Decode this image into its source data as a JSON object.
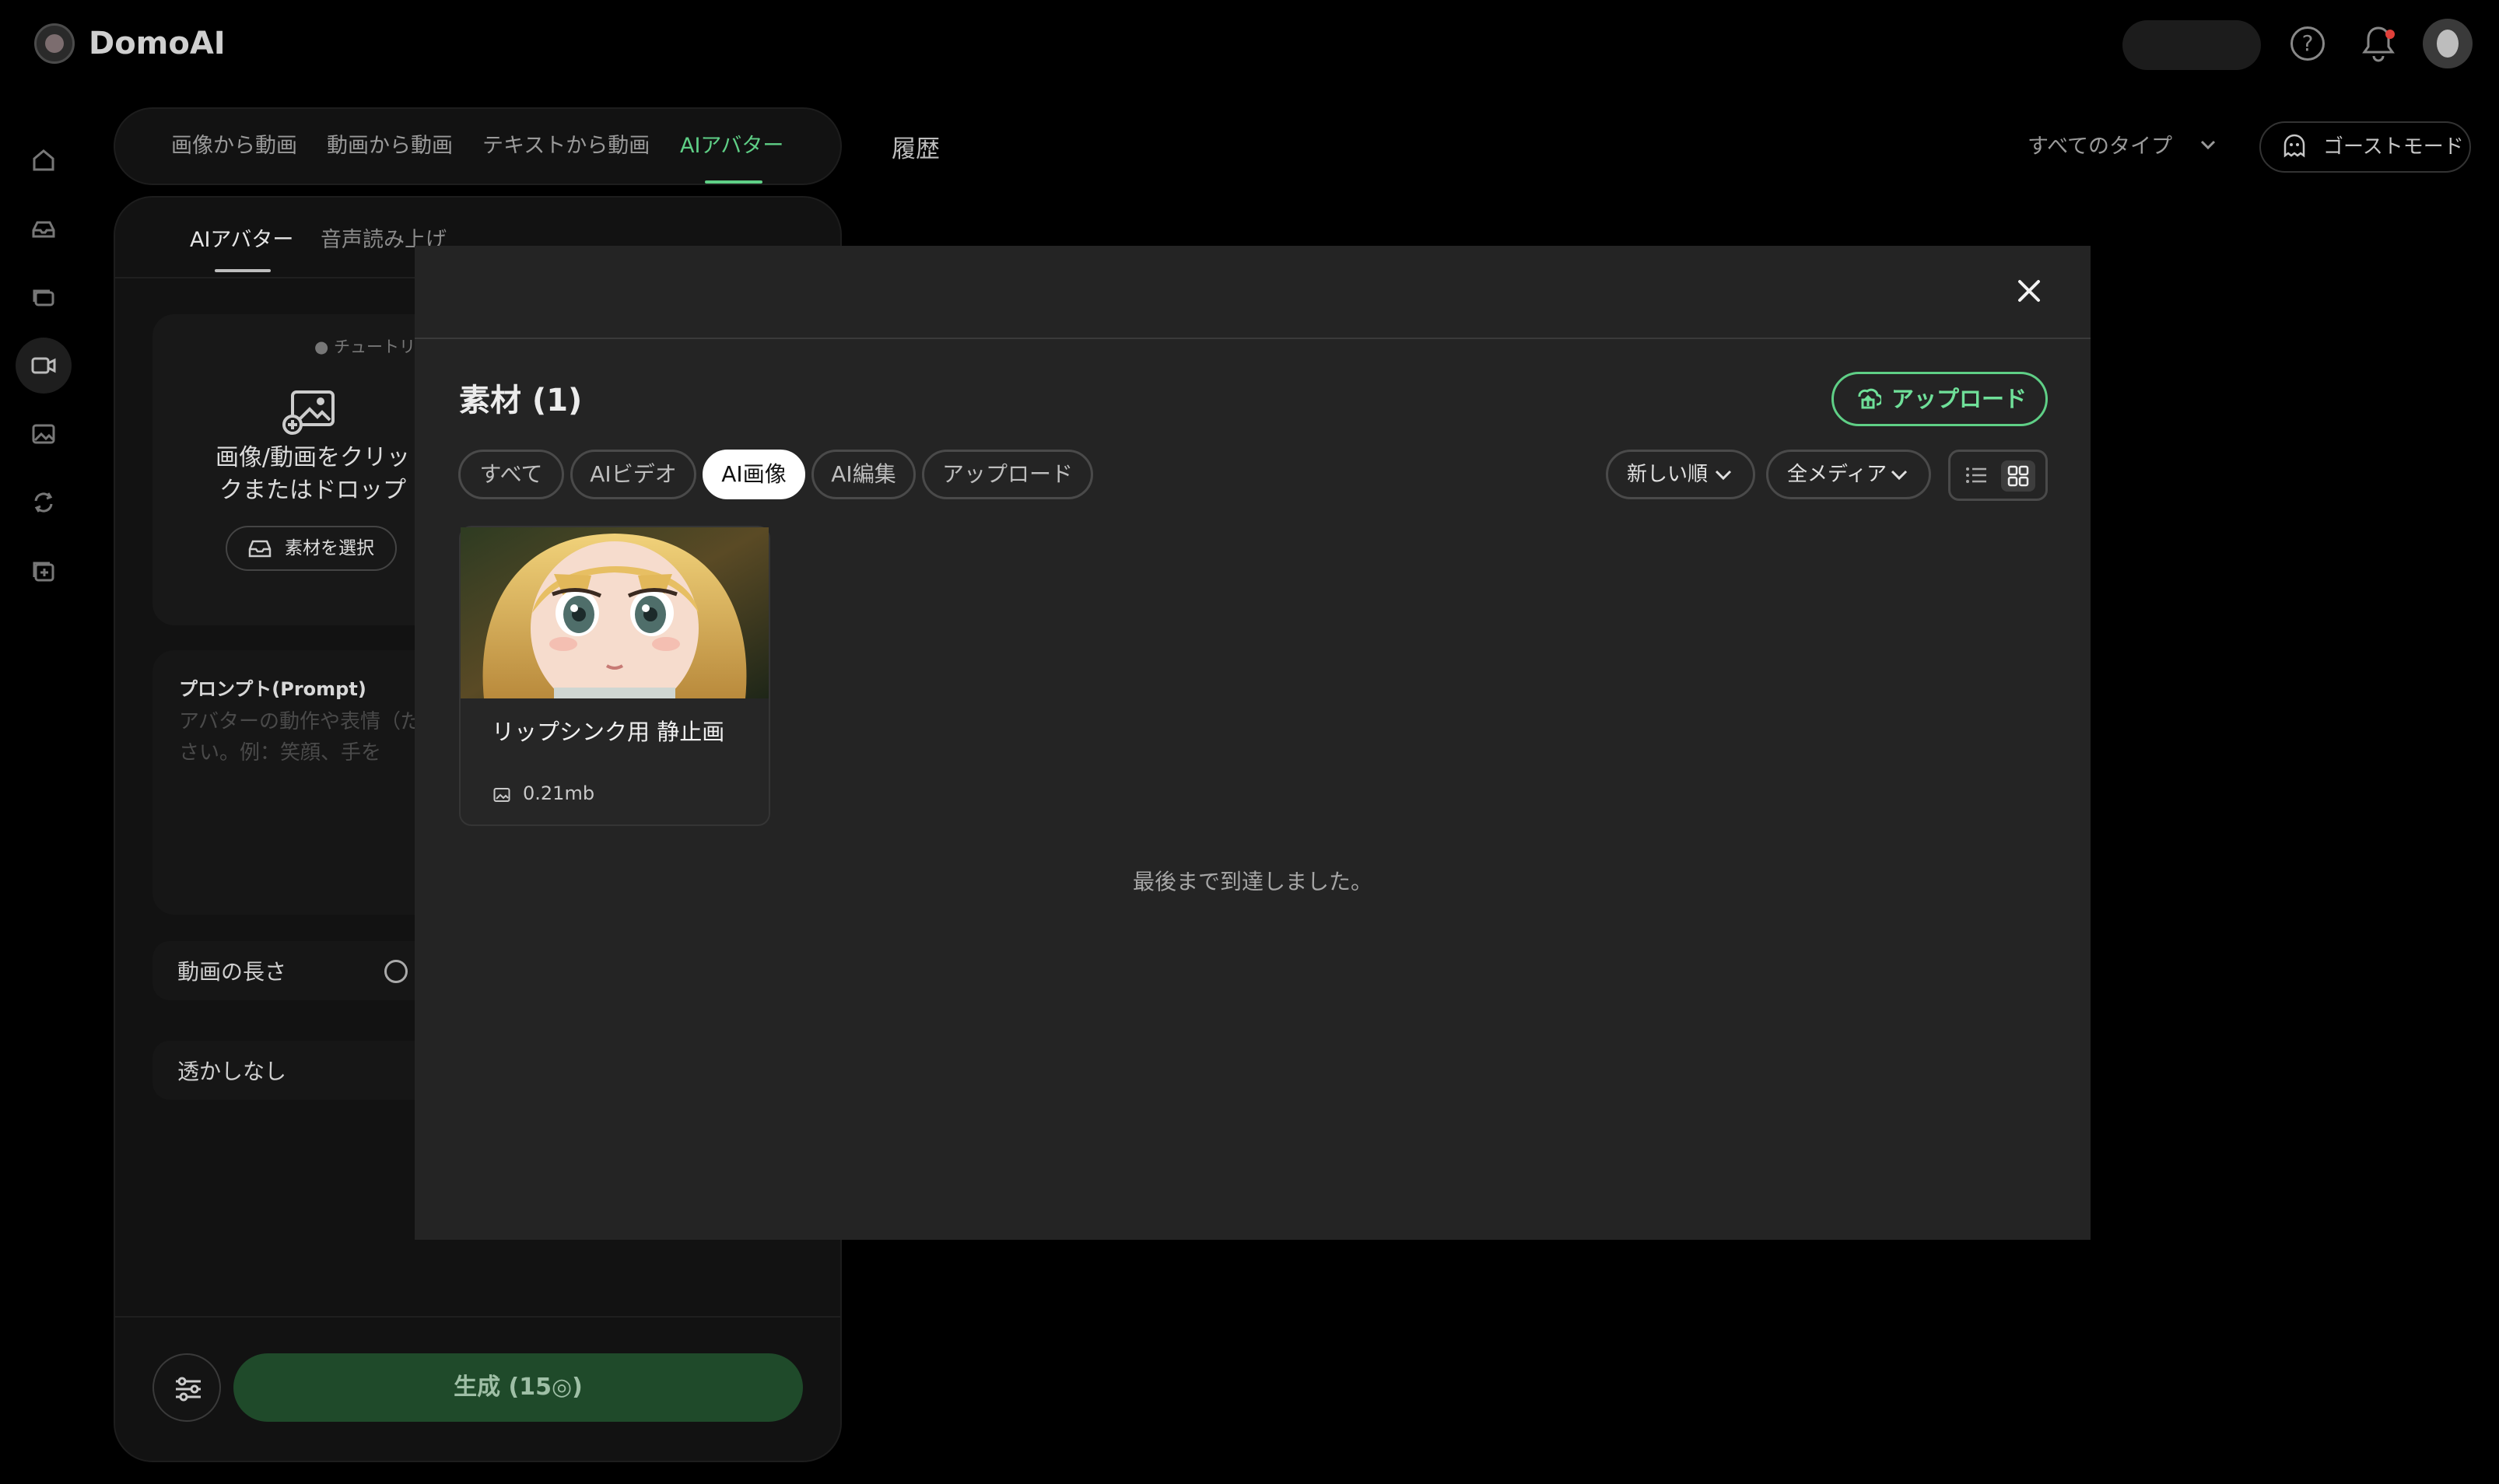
{
  "app": {
    "brand": "DomoAI"
  },
  "mode_tabs": [
    {
      "label": "画像から動画"
    },
    {
      "label": "動画から動画"
    },
    {
      "label": "テキストから動画"
    },
    {
      "label": "AIアバター"
    }
  ],
  "sub_tabs": [
    {
      "label": "AIアバター"
    },
    {
      "label": "音声読み上げ"
    }
  ],
  "panel": {
    "tutorial": "チュートリ",
    "upload_hint": "画像/動画をクリックまたはドロップ",
    "select_material": "素材を選択",
    "prompt_label": "プロンプト(Prompt)",
    "prompt_placeholder": "アバターの動作や表情（ださい。例：笑顔、手を",
    "video_length": "動画の長さ",
    "watermark": "透かしなし",
    "generate": "生成 (15◎)"
  },
  "history": {
    "title": "履歴",
    "type_filter": "すべてのタイプ",
    "ghost_mode": "ゴーストモード"
  },
  "modal": {
    "title": "素材 (1)",
    "upload": "アップロード",
    "filters": [
      "すべて",
      "AIビデオ",
      "AI画像",
      "AI編集",
      "アップロード"
    ],
    "active_filter": "AI画像",
    "sort": "新しい順",
    "media_type": "全メディア",
    "view_mode": "grid",
    "items": [
      {
        "title": "リップシンク用 静止画",
        "size": "0.21mb"
      }
    ],
    "end_message": "最後まで到達しました。"
  },
  "colors": {
    "accent": "#5fcf86",
    "modal_bg": "#242424",
    "page_bg": "#000000"
  },
  "icons": [
    "home-icon",
    "inbox-icon",
    "layers-icon",
    "video-avatar-icon",
    "image-icon",
    "loop-icon",
    "add-square-icon",
    "help-icon",
    "bell-icon",
    "close-icon",
    "cloud-upload-icon",
    "list-view-icon",
    "grid-view-icon",
    "ghost-icon",
    "clock-icon",
    "settings-sliders-icon"
  ]
}
